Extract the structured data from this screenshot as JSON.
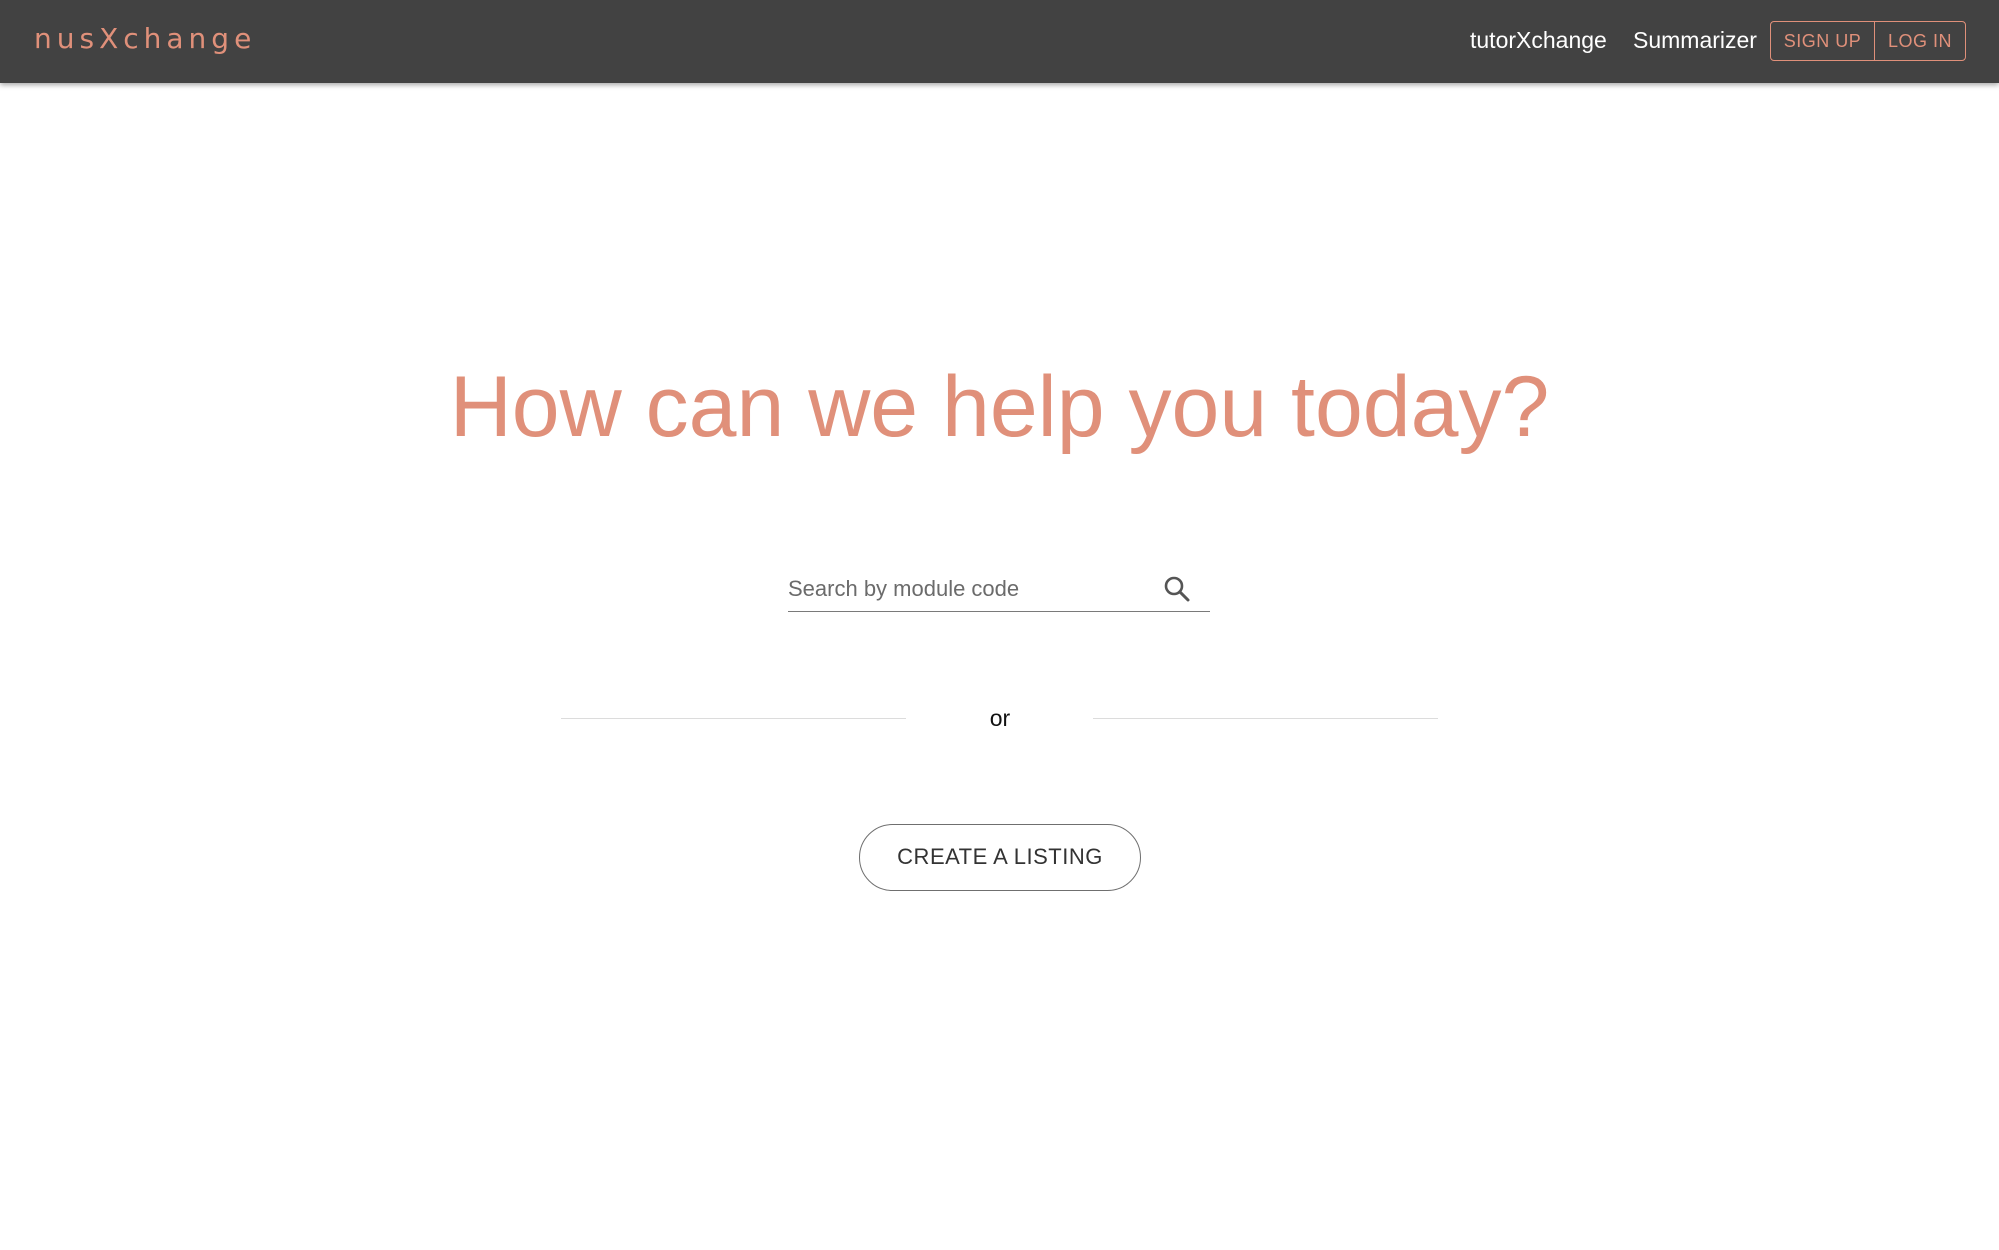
{
  "navbar": {
    "logo": "nusXchange",
    "links": [
      "tutorXchange",
      "Summarizer"
    ],
    "signup_label": "SIGN UP",
    "login_label": "LOG IN"
  },
  "main": {
    "headline": "How can we help you today?",
    "search": {
      "placeholder": "Search by module code",
      "value": ""
    },
    "separator_text": "or",
    "create_button_label": "CREATE A LISTING"
  },
  "colors": {
    "accent": "#e0907a",
    "navbar_bg": "#424242"
  }
}
